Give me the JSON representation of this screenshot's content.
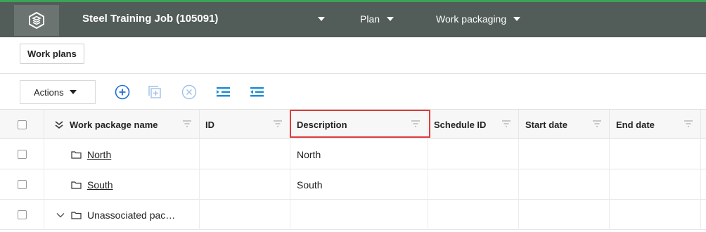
{
  "header": {
    "job_title": "Steel Training Job (105091)",
    "menus": [
      {
        "label": "Plan"
      },
      {
        "label": "Work packaging"
      }
    ],
    "accent_color": "#3aa357",
    "bar_color": "#525c58"
  },
  "tabs": {
    "work_plans_label": "Work plans"
  },
  "toolbar": {
    "actions_label": "Actions",
    "icons": [
      "add-circle-icon",
      "add-copy-icon",
      "remove-circle-icon",
      "indent-icon",
      "outdent-icon"
    ]
  },
  "grid": {
    "columns": [
      {
        "label": "Work package name"
      },
      {
        "label": "ID"
      },
      {
        "label": "Description"
      },
      {
        "label": "Schedule ID"
      },
      {
        "label": "Start date"
      },
      {
        "label": "End date"
      }
    ],
    "rows": [
      {
        "name": "North",
        "id": "",
        "description": "North",
        "schedule_id": "",
        "start_date": "",
        "end_date": ""
      },
      {
        "name": "South",
        "id": "",
        "description": "South",
        "schedule_id": "",
        "start_date": "",
        "end_date": ""
      },
      {
        "name": "Unassociated pac…",
        "id": "",
        "description": "",
        "schedule_id": "",
        "start_date": "",
        "end_date": ""
      }
    ]
  },
  "highlight_color": "#e03a3a"
}
